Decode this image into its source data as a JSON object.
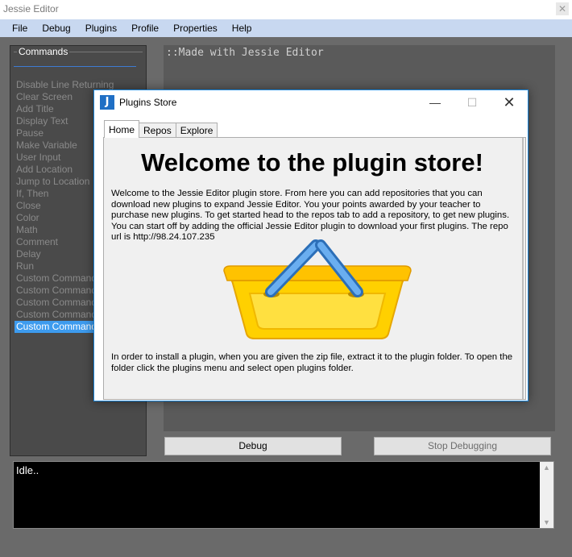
{
  "window": {
    "title": "Jessie Editor",
    "close_glyph": "✕"
  },
  "menu": [
    "File",
    "Debug",
    "Plugins",
    "Profile",
    "Properties",
    "Help"
  ],
  "commands": {
    "title": "Commands",
    "items": [
      "Disable Line Returning",
      "Clear Screen",
      "Add Title",
      "Display Text",
      "Pause",
      "Make Variable",
      "User Input",
      "Add Location",
      "Jump to Location",
      "If, Then",
      "Close",
      "Color",
      "Math",
      "Comment",
      "Delay",
      "Run",
      "Custom Command",
      "Custom Command",
      "Custom Command",
      "Custom Command",
      "Custom Command"
    ],
    "selected_index": 20
  },
  "editor": {
    "text": "::Made with Jessie Editor"
  },
  "buttons": {
    "debug": "Debug",
    "stop": "Stop Debugging"
  },
  "console": {
    "text": "Idle.."
  },
  "dialog": {
    "title": "Plugins Store",
    "icon_letter": "J",
    "min_glyph": "—",
    "max_glyph": "☐",
    "close_glyph": "✕",
    "tabs": [
      "Home",
      "Repos",
      "Explore"
    ],
    "active_tab": "Home",
    "heading": "Welcome to the plugin store!",
    "intro": "Welcome to the Jessie Editor plugin store. From here you can add repositories that you can download new plugins to expand Jessie Editor. You your points awarded by your teacher to purchase new plugins. To get started head to the repos tab to add a repository, to get new plugins. You can start off by adding the official Jessie Editor plugin to download your first plugins. The repo url is http://98.24.107.235",
    "footer": "In order to install a plugin, when you are given the zip file, extract it to the plugin folder. To open the folder click the plugins menu and select open plugins folder."
  },
  "colors": {
    "selection": "#3d9bee",
    "menubar": "#c8d8f0",
    "basket": "#ffd000",
    "basket_handle": "#4a90d9"
  }
}
